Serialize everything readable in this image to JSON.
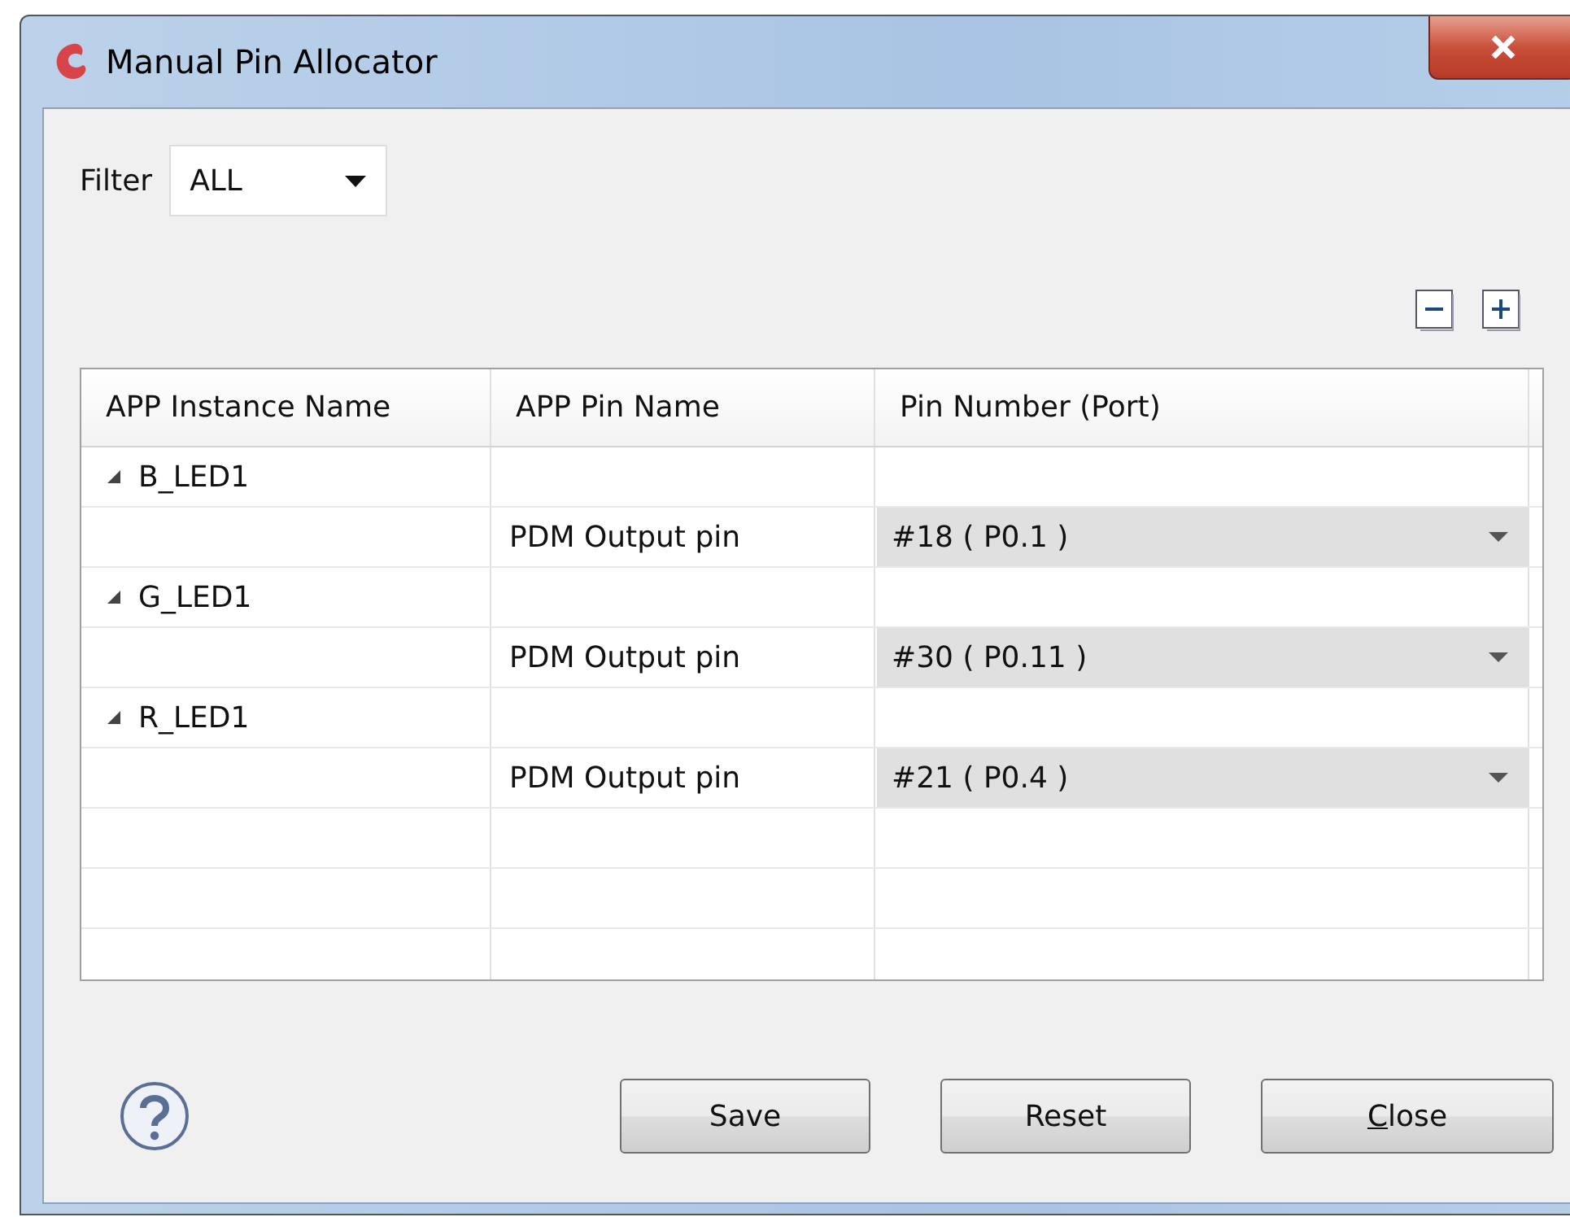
{
  "window": {
    "title": "Manual Pin Allocator"
  },
  "filter": {
    "label": "Filter",
    "value": "ALL"
  },
  "table": {
    "columns": [
      "APP Instance Name",
      "APP Pin Name",
      "Pin Number (Port)"
    ],
    "rows": [
      {
        "instance": "B_LED1",
        "expanded": true,
        "children": [
          {
            "pin_name": "PDM Output pin",
            "pin_number": "#18 ( P0.1 )"
          }
        ]
      },
      {
        "instance": "G_LED1",
        "expanded": true,
        "children": [
          {
            "pin_name": "PDM Output pin",
            "pin_number": "#30 ( P0.11 )"
          }
        ]
      },
      {
        "instance": "R_LED1",
        "expanded": true,
        "children": [
          {
            "pin_name": "PDM Output pin",
            "pin_number": "#21 ( P0.4 )"
          }
        ]
      }
    ]
  },
  "buttons": [
    {
      "label": "Save",
      "mnemonic_first": false
    },
    {
      "label": "Reset",
      "mnemonic_first": false
    },
    {
      "label": "Close",
      "mnemonic_first": true
    }
  ]
}
